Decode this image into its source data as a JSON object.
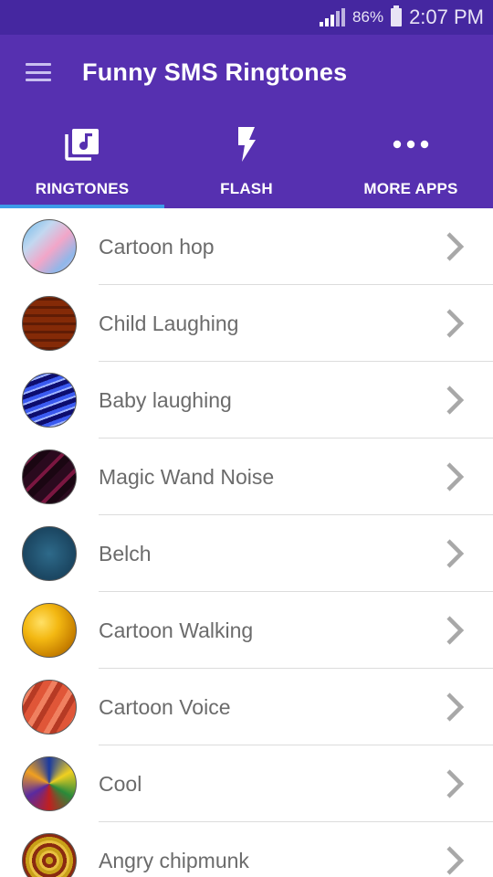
{
  "status_bar": {
    "battery_percent": "86%",
    "time": "2:07 PM"
  },
  "app_bar": {
    "menu_icon": "hamburger-menu-icon",
    "title": "Funny SMS Ringtones"
  },
  "tabs": [
    {
      "label": "RINGTONES",
      "icon": "music-library-icon",
      "selected": true
    },
    {
      "label": "FLASH",
      "icon": "flash-icon",
      "selected": false
    },
    {
      "label": "MORE APPS",
      "icon": "more-dots-icon",
      "selected": false
    }
  ],
  "colors": {
    "status_bar": "#4527a0",
    "primary": "#5630b0",
    "tab_indicator": "#3d9be8",
    "list_text": "#6b6b6b",
    "chevron": "#a8a8a8"
  },
  "ringtones": [
    {
      "name": "Cartoon hop"
    },
    {
      "name": "Child Laughing"
    },
    {
      "name": "Baby laughing"
    },
    {
      "name": "Magic Wand Noise"
    },
    {
      "name": "Belch"
    },
    {
      "name": "Cartoon Walking"
    },
    {
      "name": "Cartoon Voice"
    },
    {
      "name": "Cool"
    },
    {
      "name": "Angry chipmunk"
    }
  ]
}
